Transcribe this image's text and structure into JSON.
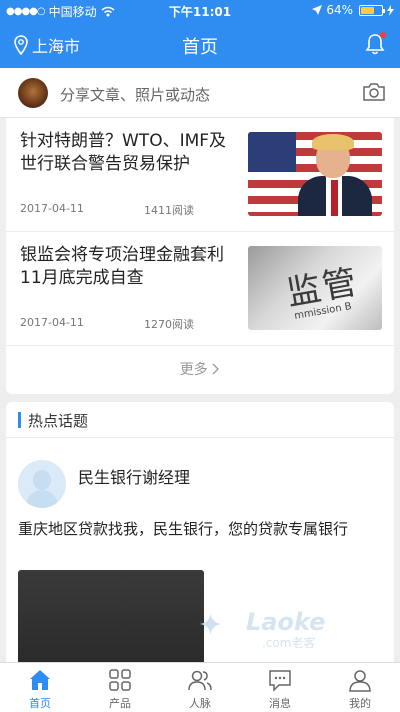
{
  "status_bar": {
    "carrier": "中国移动",
    "time": "下午11:01",
    "battery": "64%",
    "battery_level": 0.64
  },
  "nav": {
    "location": "上海市",
    "title": "首页"
  },
  "share": {
    "placeholder": "分享文章、照片或动态"
  },
  "news": [
    {
      "title": "针对特朗普？WTO、IMF及世行联合警告贸易保护",
      "date": "2017-04-11",
      "reads": "1411阅读"
    },
    {
      "title": "银监会将专项治理金融套利 11月底完成自查",
      "date": "2017-04-11",
      "reads": "1270阅读"
    }
  ],
  "thumb_sign": {
    "chars": "监管",
    "sub": "mmission B"
  },
  "more_label": "更多",
  "hot_topics": {
    "title": "热点话题",
    "author": "民生银行谢经理",
    "text": "重庆地区贷款找我，民生银行，您的贷款专属银行"
  },
  "watermark": {
    "text": "Laoke",
    "sub": ".com老客"
  },
  "tabs": [
    {
      "label": "首页",
      "icon": "home-icon",
      "active": true
    },
    {
      "label": "产品",
      "icon": "grid-icon",
      "active": false
    },
    {
      "label": "人脉",
      "icon": "contacts-icon",
      "active": false
    },
    {
      "label": "消息",
      "icon": "message-icon",
      "active": false
    },
    {
      "label": "我的",
      "icon": "profile-icon",
      "active": false
    }
  ],
  "colors": {
    "accent": "#2f8cf0",
    "background": "#eeeeee"
  }
}
